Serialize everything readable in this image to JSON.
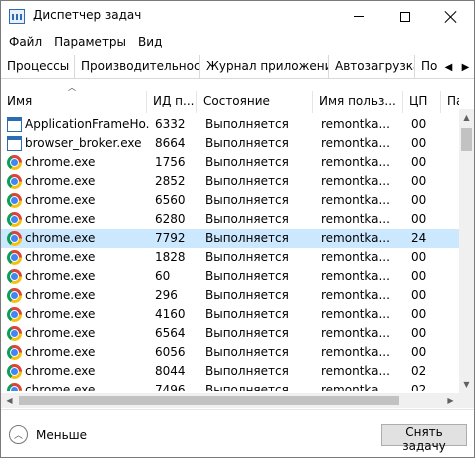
{
  "window": {
    "title": "Диспетчер задач"
  },
  "menu": [
    "Файл",
    "Параметры",
    "Вид"
  ],
  "tabs": [
    "Процессы",
    "Производительность",
    "Журнал приложений",
    "Автозагрузка",
    "По"
  ],
  "columns": {
    "name": "Имя",
    "pid": "ИД п...",
    "state": "Состояние",
    "user": "Имя польз...",
    "cpu": "ЦП",
    "extra": "Па"
  },
  "rows": [
    {
      "icon": "window-app-icon",
      "name": "ApplicationFrameHo...",
      "pid": "6332",
      "state": "Выполняется",
      "user": "remontka...",
      "cpu": "00"
    },
    {
      "icon": "window-app-icon",
      "name": "browser_broker.exe",
      "pid": "8664",
      "state": "Выполняется",
      "user": "remontka...",
      "cpu": "00"
    },
    {
      "icon": "chrome-icon",
      "name": "chrome.exe",
      "pid": "1756",
      "state": "Выполняется",
      "user": "remontka...",
      "cpu": "00"
    },
    {
      "icon": "chrome-icon",
      "name": "chrome.exe",
      "pid": "2852",
      "state": "Выполняется",
      "user": "remontka...",
      "cpu": "00"
    },
    {
      "icon": "chrome-icon",
      "name": "chrome.exe",
      "pid": "6560",
      "state": "Выполняется",
      "user": "remontka...",
      "cpu": "00"
    },
    {
      "icon": "chrome-icon",
      "name": "chrome.exe",
      "pid": "6280",
      "state": "Выполняется",
      "user": "remontka...",
      "cpu": "00"
    },
    {
      "icon": "chrome-icon",
      "name": "chrome.exe",
      "pid": "7792",
      "state": "Выполняется",
      "user": "remontka...",
      "cpu": "24",
      "selected": true
    },
    {
      "icon": "chrome-icon",
      "name": "chrome.exe",
      "pid": "1828",
      "state": "Выполняется",
      "user": "remontka...",
      "cpu": "00"
    },
    {
      "icon": "chrome-icon",
      "name": "chrome.exe",
      "pid": "60",
      "state": "Выполняется",
      "user": "remontka...",
      "cpu": "00"
    },
    {
      "icon": "chrome-icon",
      "name": "chrome.exe",
      "pid": "296",
      "state": "Выполняется",
      "user": "remontka...",
      "cpu": "00"
    },
    {
      "icon": "chrome-icon",
      "name": "chrome.exe",
      "pid": "4160",
      "state": "Выполняется",
      "user": "remontka...",
      "cpu": "00"
    },
    {
      "icon": "chrome-icon",
      "name": "chrome.exe",
      "pid": "6564",
      "state": "Выполняется",
      "user": "remontka...",
      "cpu": "00"
    },
    {
      "icon": "chrome-icon",
      "name": "chrome.exe",
      "pid": "6056",
      "state": "Выполняется",
      "user": "remontka...",
      "cpu": "00"
    },
    {
      "icon": "chrome-icon",
      "name": "chrome.exe",
      "pid": "8044",
      "state": "Выполняется",
      "user": "remontka...",
      "cpu": "02"
    },
    {
      "icon": "chrome-icon",
      "name": "chrome.exe",
      "pid": "7496",
      "state": "Выполняется",
      "user": "remontka...",
      "cpu": "02"
    }
  ],
  "footer": {
    "less_label": "Меньше",
    "end_task_label": "Снять задачу"
  }
}
